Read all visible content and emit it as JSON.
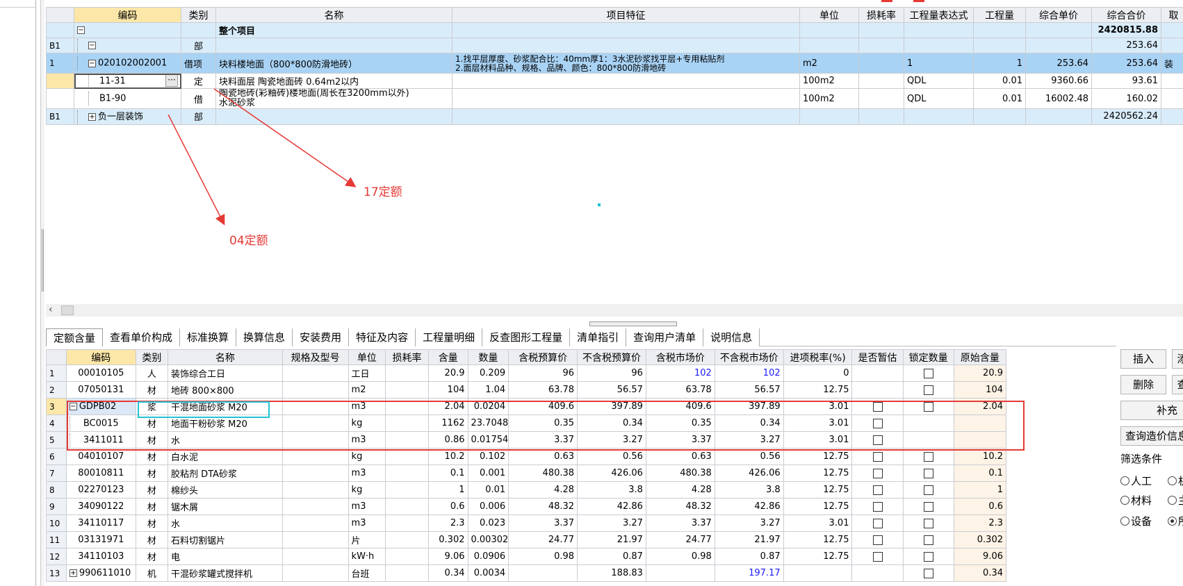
{
  "upper": {
    "headers": [
      "编码",
      "类别",
      "名称",
      "项目特征",
      "单位",
      "损耗率",
      "工程量表达式",
      "工程量",
      "综合单价",
      "综合合价",
      "取"
    ],
    "rows": [
      {
        "idx": "",
        "code": "",
        "type": "",
        "name": "整个项目",
        "feature": "",
        "unit": "",
        "loss": "",
        "expr": "",
        "qty": "",
        "price": "",
        "total": "2420815.88",
        "extra": ""
      },
      {
        "idx": "B1",
        "code": "",
        "type": "部",
        "name": "",
        "feature": "",
        "unit": "",
        "loss": "",
        "expr": "",
        "qty": "",
        "price": "",
        "total": "253.64",
        "extra": ""
      },
      {
        "idx": "1",
        "code": "020102002001",
        "type": "借项",
        "name": "块料楼地面（800*800防滑地砖）",
        "feature1": "1.找平层厚度、砂浆配合比：40mm厚1：3水泥砂浆找平层+专用粘贴剂",
        "feature2": "2.面层材料品种、规格、品牌、颜色：800*800防滑地砖",
        "unit": "m2",
        "loss": "",
        "expr": "1",
        "qty": "1",
        "price": "253.64",
        "total": "253.64",
        "extra": "装"
      },
      {
        "idx": "",
        "code": "11-31",
        "type": "定",
        "name": "块料面层 陶瓷地面砖 0.64m2以内",
        "feature": "",
        "unit": "100m2",
        "loss": "",
        "expr": "QDL",
        "qty": "0.01",
        "price": "9360.66",
        "total": "93.61",
        "extra": ""
      },
      {
        "idx": "",
        "code": "B1-90",
        "type": "借",
        "name1": "陶瓷地砖(彩釉砖)楼地面(周长在3200mm以外)",
        "name2": "水泥砂浆",
        "feature": "",
        "unit": "100m2",
        "loss": "",
        "expr": "QDL",
        "qty": "0.01",
        "price": "16002.48",
        "total": "160.02",
        "extra": ""
      },
      {
        "idx": "B1",
        "code": "",
        "type": "部",
        "name": "负一层装饰",
        "feature": "",
        "unit": "",
        "loss": "",
        "expr": "",
        "qty": "",
        "price": "",
        "total": "2420562.24",
        "extra": ""
      }
    ]
  },
  "annotations": {
    "label_17": "17定额",
    "label_04": "04定额"
  },
  "tabs": [
    "定额含量",
    "查看单价构成",
    "标准换算",
    "换算信息",
    "安装费用",
    "特征及内容",
    "工程量明细",
    "反查图形工程量",
    "清单指引",
    "查询用户清单",
    "说明信息"
  ],
  "lower": {
    "headers": [
      "编码",
      "类别",
      "名称",
      "规格及型号",
      "单位",
      "损耗率",
      "含量",
      "数量",
      "含税预算价",
      "不含税预算价",
      "含税市场价",
      "不含税市场价",
      "进项税率(%)",
      "是否暂估",
      "锁定数量",
      "原始含量"
    ],
    "rows": [
      {
        "n": "1",
        "code": "00010105",
        "type": "人",
        "name": "装饰综合工日",
        "spec": "",
        "unit": "工日",
        "loss": "",
        "cont": "20.9",
        "qty": "0.209",
        "p1": "96",
        "p2": "96",
        "p3": "102",
        "p4": "102",
        "tax": "0",
        "orig": "20.9"
      },
      {
        "n": "2",
        "code": "07050131",
        "type": "材",
        "name": "地砖 800×800",
        "spec": "",
        "unit": "m2",
        "loss": "",
        "cont": "104",
        "qty": "1.04",
        "p1": "63.78",
        "p2": "56.57",
        "p3": "63.78",
        "p4": "56.57",
        "tax": "12.75",
        "orig": "104"
      },
      {
        "n": "3",
        "code": "GDPB02",
        "type": "浆",
        "name": "干混地面砂浆 M20",
        "spec": "",
        "unit": "m3",
        "loss": "",
        "cont": "2.04",
        "qty": "0.0204",
        "p1": "409.6",
        "p2": "397.89",
        "p3": "409.6",
        "p4": "397.89",
        "tax": "3.01",
        "orig": "2.04"
      },
      {
        "n": "4",
        "code": "BC0015",
        "type": "材",
        "name": "地面干粉砂浆 M20",
        "spec": "",
        "unit": "kg",
        "loss": "",
        "cont": "1162",
        "qty": "23.7048",
        "p1": "0.35",
        "p2": "0.34",
        "p3": "0.35",
        "p4": "0.34",
        "tax": "3.01",
        "orig": ""
      },
      {
        "n": "5",
        "code": "3411011",
        "type": "材",
        "name": "水",
        "spec": "",
        "unit": "m3",
        "loss": "",
        "cont": "0.86",
        "qty": "0.01754",
        "p1": "3.37",
        "p2": "3.27",
        "p3": "3.37",
        "p4": "3.27",
        "tax": "3.01",
        "orig": ""
      },
      {
        "n": "6",
        "code": "04010107",
        "type": "材",
        "name": "白水泥",
        "spec": "",
        "unit": "kg",
        "loss": "",
        "cont": "10.2",
        "qty": "0.102",
        "p1": "0.63",
        "p2": "0.56",
        "p3": "0.63",
        "p4": "0.56",
        "tax": "12.75",
        "orig": "10.2"
      },
      {
        "n": "7",
        "code": "80010811",
        "type": "材",
        "name": "胶粘剂 DTA砂浆",
        "spec": "",
        "unit": "m3",
        "loss": "",
        "cont": "0.1",
        "qty": "0.001",
        "p1": "480.38",
        "p2": "426.06",
        "p3": "480.38",
        "p4": "426.06",
        "tax": "12.75",
        "orig": "0.1"
      },
      {
        "n": "8",
        "code": "02270123",
        "type": "材",
        "name": "棉纱头",
        "spec": "",
        "unit": "kg",
        "loss": "",
        "cont": "1",
        "qty": "0.01",
        "p1": "4.28",
        "p2": "3.8",
        "p3": "4.28",
        "p4": "3.8",
        "tax": "12.75",
        "orig": "1"
      },
      {
        "n": "9",
        "code": "34090122",
        "type": "材",
        "name": "锯木屑",
        "spec": "",
        "unit": "m3",
        "loss": "",
        "cont": "0.6",
        "qty": "0.006",
        "p1": "48.32",
        "p2": "42.86",
        "p3": "48.32",
        "p4": "42.86",
        "tax": "12.75",
        "orig": "0.6"
      },
      {
        "n": "10",
        "code": "34110117",
        "type": "材",
        "name": "水",
        "spec": "",
        "unit": "m3",
        "loss": "",
        "cont": "2.3",
        "qty": "0.023",
        "p1": "3.37",
        "p2": "3.27",
        "p3": "3.37",
        "p4": "3.27",
        "tax": "3.01",
        "orig": "2.3"
      },
      {
        "n": "11",
        "code": "03131971",
        "type": "材",
        "name": "石料切割锯片",
        "spec": "",
        "unit": "片",
        "loss": "",
        "cont": "0.302",
        "qty": "0.00302",
        "p1": "24.77",
        "p2": "21.97",
        "p3": "24.77",
        "p4": "21.97",
        "tax": "12.75",
        "orig": "0.302"
      },
      {
        "n": "12",
        "code": "34110103",
        "type": "材",
        "name": "电",
        "spec": "",
        "unit": "kW·h",
        "loss": "",
        "cont": "9.06",
        "qty": "0.0906",
        "p1": "0.98",
        "p2": "0.87",
        "p3": "0.98",
        "p4": "0.87",
        "tax": "12.75",
        "orig": "9.06"
      },
      {
        "n": "13",
        "code": "990611010",
        "type": "机",
        "name": "干混砂浆罐式搅拌机",
        "spec": "",
        "unit": "台班",
        "loss": "",
        "cont": "0.34",
        "qty": "0.0034",
        "p1": "",
        "p2": "188.83",
        "p3": "",
        "p4": "197.17",
        "tax": "",
        "orig": "0.34"
      }
    ]
  },
  "side": {
    "insert": "插入",
    "add": "添",
    "delete": "删除",
    "query": "查",
    "supplement": "补充",
    "price_info": "查询造价信息",
    "filter_title": "筛选条件",
    "radios": [
      "人工",
      "材料",
      "设备",
      "机",
      "主",
      "所"
    ]
  },
  "colors": {
    "header_highlight": "#fce7a8",
    "selected_row": "#a9d3f5",
    "group_row": "#d9ecf9",
    "annotation_red": "#e53935",
    "blue_value": "#1a1aff"
  }
}
